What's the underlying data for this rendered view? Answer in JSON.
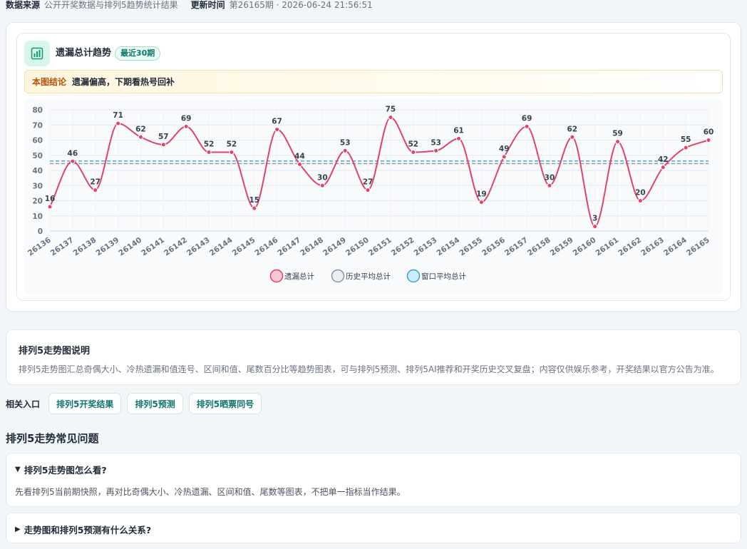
{
  "meta": {
    "source_label": "数据来源",
    "source_value": "公开开奖数据与排列5趋势统计结果",
    "updated_label": "更新时间",
    "updated_value": "第26165期 · 2026-06-24 21:56:51"
  },
  "card": {
    "title": "遗漏总计趋势",
    "badge": "最近30期",
    "icon": "bar-chart-icon",
    "conclusion_tag": "本图结论",
    "conclusion_text": "遗漏偏高，下期看热号回补"
  },
  "colors": {
    "series_line": "#e0426a",
    "history_avg": "#8a92a6",
    "window_avg": "#3aa5c6",
    "accent": "#0f766e"
  },
  "chart_data": {
    "type": "line",
    "title": "",
    "xlabel": "",
    "ylabel": "",
    "x": [
      "26136",
      "26137",
      "26138",
      "26139",
      "26140",
      "26141",
      "26142",
      "26143",
      "26144",
      "26145",
      "26146",
      "26147",
      "26148",
      "26149",
      "26150",
      "26151",
      "26152",
      "26153",
      "26154",
      "26155",
      "26156",
      "26157",
      "26158",
      "26159",
      "26160",
      "26161",
      "26162",
      "26163",
      "26164",
      "26165"
    ],
    "series": [
      {
        "name": "遗漏总计",
        "values": [
          16,
          46,
          27,
          71,
          62,
          57,
          69,
          52,
          52,
          15,
          67,
          44,
          30,
          53,
          27,
          75,
          52,
          53,
          61,
          19,
          49,
          69,
          30,
          62,
          3,
          59,
          20,
          42,
          55,
          60
        ]
      }
    ],
    "reference_lines": [
      {
        "name": "历史平均总计",
        "value": 44.5
      },
      {
        "name": "窗口平均总计",
        "value": 46.2
      }
    ],
    "ylim": [
      0,
      80
    ],
    "yticks": [
      0,
      10,
      20,
      30,
      40,
      50,
      60,
      70,
      80
    ],
    "grid": true,
    "legend_position": "bottom"
  },
  "explain": {
    "title": "排列5走势图说明",
    "text": "排列5走势图汇总奇偶大小、冷热遗漏和值连号、区间和值、尾数百分比等趋势图表，可与排列5预测、排列5AI推荐和开奖历史交叉复盘；内容仅供娱乐参考，开奖结果以官方公告为准。"
  },
  "related": {
    "label": "相关入口",
    "links": [
      "排列5开奖结果",
      "排列5预测",
      "排列5晒票同号"
    ]
  },
  "faq": {
    "title": "排列5走势常见问题",
    "items": [
      {
        "question": "排列5走势图怎么看?",
        "answer": "先看排列5当前期快照，再对比奇偶大小、冷热遗漏、区间和值、尾数等图表，不把单一指标当作结果。",
        "expanded": true
      },
      {
        "question": "走势图和排列5预测有什么关系?",
        "answer": "",
        "expanded": false
      }
    ]
  }
}
